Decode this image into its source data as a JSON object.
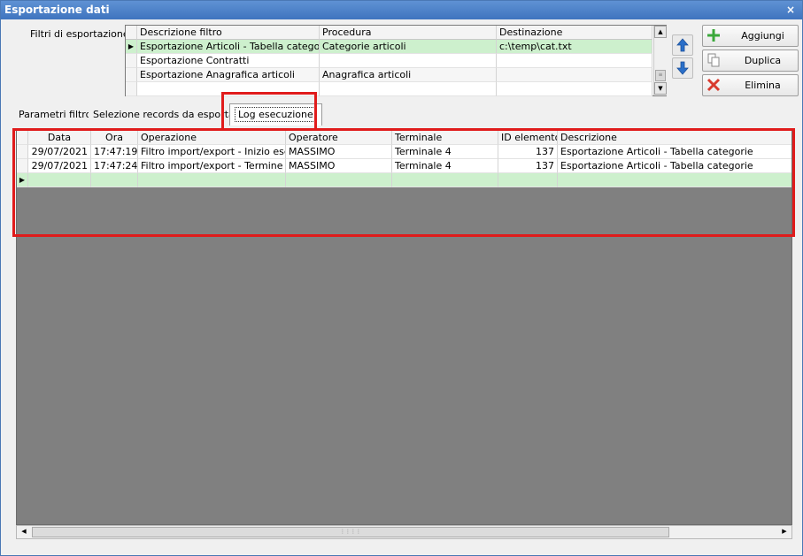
{
  "window": {
    "title": "Esportazione dati",
    "close_glyph": "×"
  },
  "filters": {
    "label": "Filtri di esportazione :",
    "columns": [
      "Descrizione filtro",
      "Procedura",
      "Destinazione"
    ],
    "rows": [
      {
        "descrizione": "Esportazione Articoli - Tabella categorie",
        "procedura": "Categorie articoli",
        "destinazione": "c:\\temp\\cat.txt",
        "selected": true
      },
      {
        "descrizione": "Esportazione Contratti",
        "procedura": "",
        "destinazione": "",
        "selected": false
      },
      {
        "descrizione": "Esportazione Anagrafica articoli",
        "procedura": "Anagrafica articoli",
        "destinazione": "",
        "selected": false
      }
    ]
  },
  "buttons": {
    "add": "Aggiungi",
    "duplicate": "Duplica",
    "delete": "Elimina"
  },
  "icons": {
    "move_up": "arrow-up-icon",
    "move_down": "arrow-down-icon",
    "add": "plus-icon",
    "duplicate": "copy-icon",
    "delete": "x-icon"
  },
  "tabs": [
    {
      "label": "Parametri filtro",
      "active": false
    },
    {
      "label": "Selezione records da esportare",
      "active": false
    },
    {
      "label": "Log esecuzione",
      "active": true
    }
  ],
  "log": {
    "columns": [
      "Data",
      "Ora",
      "Operazione",
      "Operatore",
      "Terminale",
      "ID elemento",
      "Descrizione"
    ],
    "rows": [
      {
        "data": "29/07/2021",
        "ora": "17:47:19",
        "operazione": "Filtro import/export - Inizio ese...",
        "operatore": "MASSIMO",
        "terminale": "Terminale 4",
        "id": "137",
        "descrizione": "Esportazione Articoli - Tabella categorie"
      },
      {
        "data": "29/07/2021",
        "ora": "17:47:24",
        "operazione": "Filtro import/export - Termine ...",
        "operatore": "MASSIMO",
        "terminale": "Terminale 4",
        "id": "137",
        "descrizione": "Esportazione Articoli - Tabella categorie"
      }
    ]
  },
  "colors": {
    "highlight_box": "#e01b1b",
    "selected_row": "#cdf0cd",
    "titlebar": "#4a7fc7",
    "empty_area": "#808080"
  }
}
